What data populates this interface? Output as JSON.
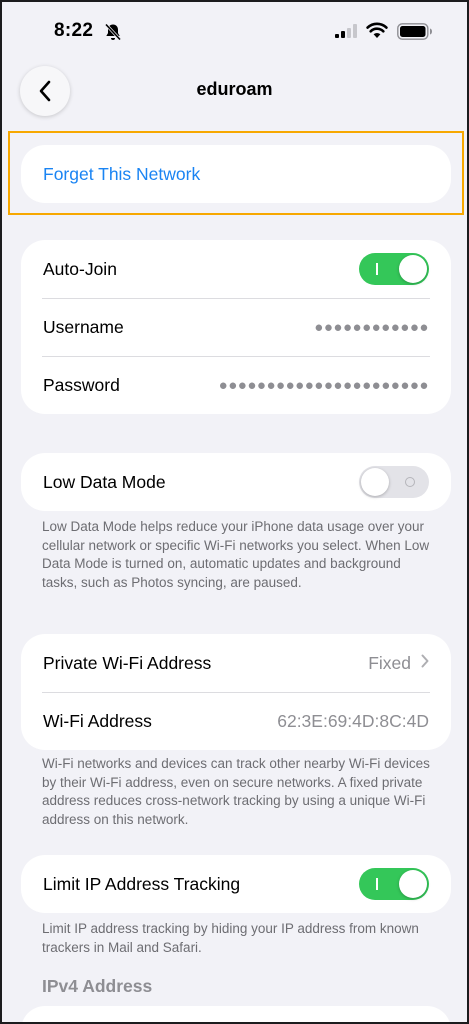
{
  "status_bar": {
    "time": "8:22"
  },
  "nav": {
    "title": "eduroam"
  },
  "forget": {
    "label": "Forget This Network"
  },
  "credentials": {
    "auto_join_label": "Auto-Join",
    "auto_join_on": true,
    "username_label": "Username",
    "username_value": "●●●●●●●●●●●●",
    "password_label": "Password",
    "password_value": "●●●●●●●●●●●●●●●●●●●●●●"
  },
  "low_data": {
    "label": "Low Data Mode",
    "on": false,
    "footnote": "Low Data Mode helps reduce your iPhone data usage over your cellular network or specific Wi-Fi networks you select. When Low Data Mode is turned on, automatic updates and background tasks, such as Photos syncing, are paused."
  },
  "address": {
    "private_label": "Private Wi-Fi Address",
    "private_value": "Fixed",
    "wifi_label": "Wi-Fi Address",
    "wifi_value": "62:3E:69:4D:8C:4D",
    "footnote": "Wi-Fi networks and devices can track other nearby Wi-Fi devices by their Wi-Fi address, even on secure networks. A fixed private address reduces cross-network tracking by using a unique Wi-Fi address on this network."
  },
  "limit_ip": {
    "label": "Limit IP Address Tracking",
    "on": true,
    "footnote": "Limit IP address tracking by hiding your IP address from known trackers in Mail and Safari."
  },
  "ipv4": {
    "header": "IPv4 Address"
  },
  "colors": {
    "accent": "#1a84f3",
    "toggle_on": "#34c759",
    "highlight": "#f7a800"
  }
}
